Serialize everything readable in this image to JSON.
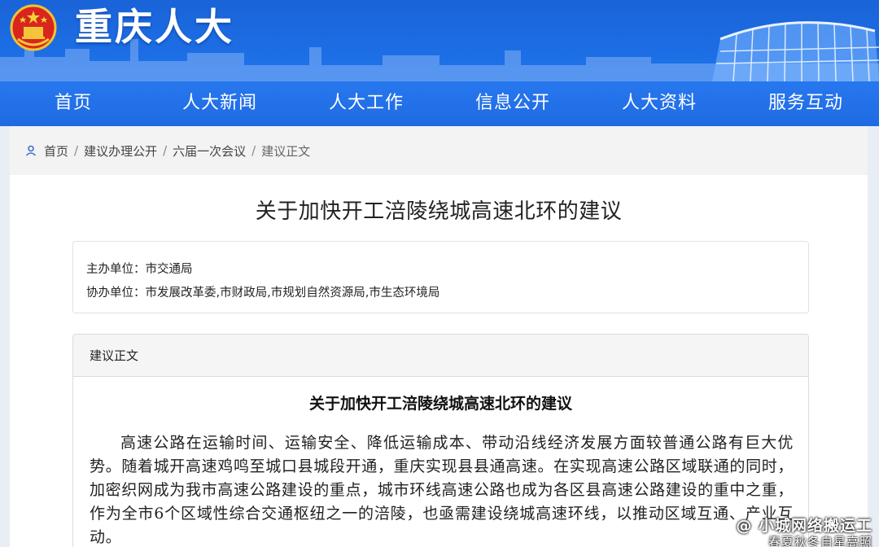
{
  "header": {
    "site_title": "重庆人大",
    "colors": {
      "primary_blue": "#1d6fe6",
      "nav_blue": "#2878f0"
    }
  },
  "nav": {
    "items": [
      {
        "label": "首页"
      },
      {
        "label": "人大新闻"
      },
      {
        "label": "人大工作"
      },
      {
        "label": "信息公开"
      },
      {
        "label": "人大资料"
      },
      {
        "label": "服务互动"
      }
    ]
  },
  "breadcrumb": {
    "icon": "location-person-icon",
    "items": [
      "首页",
      "建议办理公开",
      "六届一次会议",
      "建议正文"
    ]
  },
  "page": {
    "title": "关于加快开工涪陵绕城高速北环的建议"
  },
  "units": {
    "lead_label": "主办单位：",
    "lead_value": "市交通局",
    "assist_label": "协办单位：",
    "assist_value": "市发展改革委,市财政局,市规划自然资源局,市生态环境局"
  },
  "body_panel": {
    "heading": "建议正文",
    "doc_title": "关于加快开工涪陵绕城高速北环的建议",
    "paragraph": "高速公路在运输时间、运输安全、降低运输成本、带动沿线经济发展方面较普通公路有巨大优势。随着城开高速鸡鸣至城口县城段开通，重庆实现县县通高速。在实现高速公路区域联通的同时，加密织网成为我市高速公路建设的重点，城市环线高速公路也成为各区县高速公路建设的重中之重，作为全市6个区域性综合交通枢纽之一的涪陵，也亟需建设绕城高速环线，以推动区域互通、产业互动。"
  },
  "watermark": {
    "line1": "@ 小城网络搬运工",
    "line2": "春夏秋冬自星高照"
  }
}
